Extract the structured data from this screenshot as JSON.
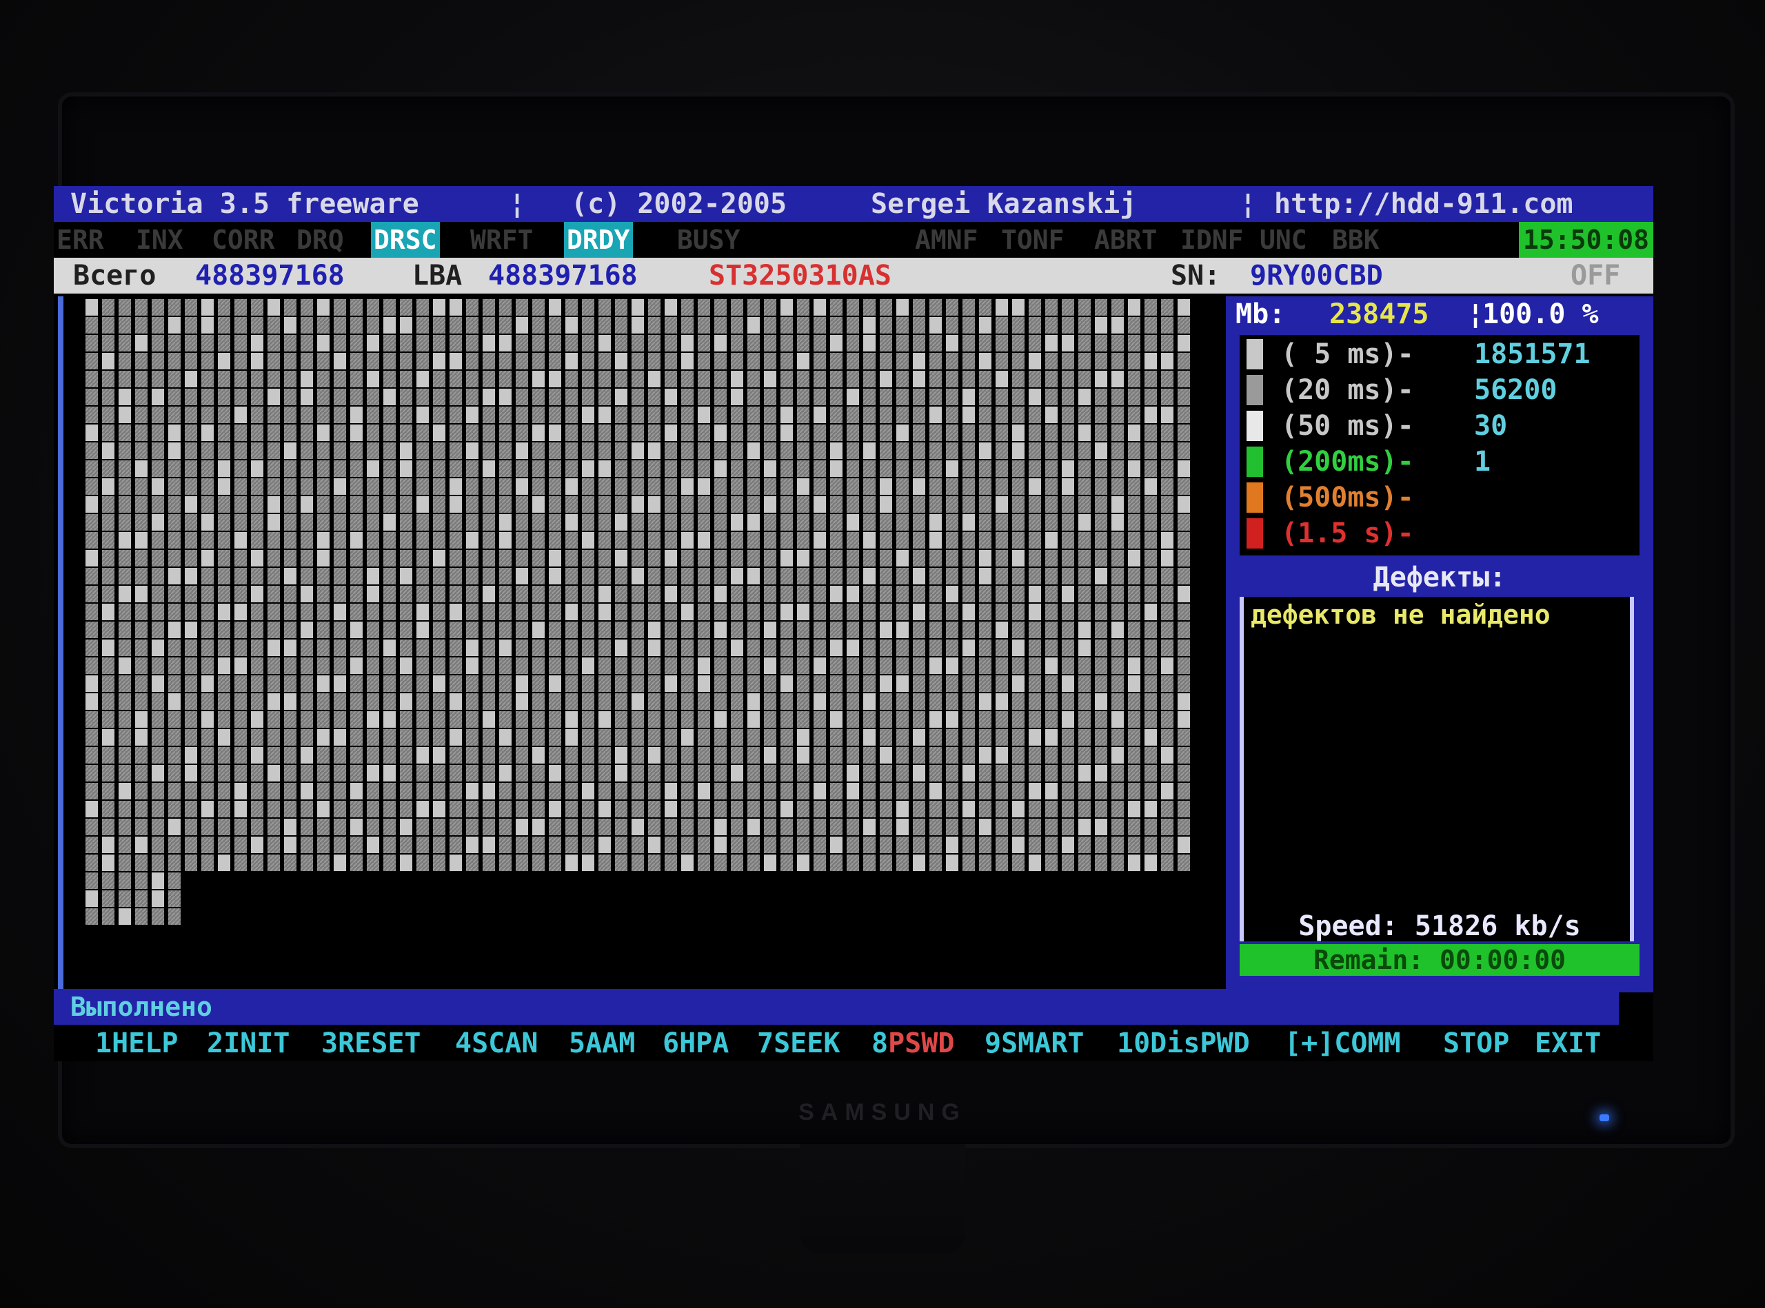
{
  "title_bar": {
    "app": "Victoria 3.5 freeware",
    "sep1": "¦",
    "copyright": "(c) 2002-2005",
    "author": "Sergei Kazanskij",
    "sep2": "¦",
    "url": "http://hdd-911.com"
  },
  "flags": [
    {
      "label": "ERR",
      "active": false
    },
    {
      "label": "INX",
      "active": false
    },
    {
      "label": "CORR",
      "active": false
    },
    {
      "label": "DRQ",
      "active": false
    },
    {
      "label": "DRSC",
      "active": true
    },
    {
      "label": "WRFT",
      "active": false
    },
    {
      "label": "DRDY",
      "active": true
    },
    {
      "label": "BUSY",
      "active": false
    },
    {
      "label": "AMNF",
      "active": false
    },
    {
      "label": "TONF",
      "active": false
    },
    {
      "label": "ABRT",
      "active": false
    },
    {
      "label": "IDNF",
      "active": false
    },
    {
      "label": "UNC",
      "active": false
    },
    {
      "label": "BBK",
      "active": false
    }
  ],
  "clock": "15:50:08",
  "info": {
    "total_label": "Всего",
    "total_value": "488397168",
    "lba_label": "LBA",
    "lba_value": "488397168",
    "model": "ST3250310AS",
    "sn_label": "SN:",
    "sn_value": "9RY00CBD",
    "state": "OFF"
  },
  "summary": {
    "mb_label": "Mb:",
    "mb_value": "238475",
    "sep": "¦",
    "percent": "100.0 %"
  },
  "timing_stats": [
    {
      "label": "( 5 ms)-",
      "count": "1851571",
      "color": "#c8c8c8",
      "label_color": "#c8c8c8"
    },
    {
      "label": "(20 ms)-",
      "count": "56200",
      "color": "#9a9a9a",
      "label_color": "#c8c8c8"
    },
    {
      "label": "(50 ms)-",
      "count": "30",
      "color": "#e8e8e8",
      "label_color": "#c8c8c8"
    },
    {
      "label": "(200ms)-",
      "count": "1",
      "color": "#22c030",
      "label_color": "#30d040"
    },
    {
      "label": "(500ms)-",
      "count": "",
      "color": "#e07820",
      "label_color": "#e08030"
    },
    {
      "label": "(1.5 s)-",
      "count": "",
      "color": "#d02020",
      "label_color": "#e03030"
    }
  ],
  "defects": {
    "header": "Дефекты:",
    "message": "дефектов не найдено"
  },
  "speed": {
    "label": "Speed:",
    "value": "51826 kb/s"
  },
  "remain": {
    "label": "Remain:",
    "value": "00:00:00"
  },
  "status_text": "Выполнено",
  "function_keys": [
    {
      "num": "1",
      "text": "HELP",
      "style": ""
    },
    {
      "num": "2",
      "text": "INIT",
      "style": ""
    },
    {
      "num": "3",
      "text": "RESET",
      "style": ""
    },
    {
      "num": "4",
      "text": "SCAN",
      "style": ""
    },
    {
      "num": "5",
      "text": "AAM",
      "style": ""
    },
    {
      "num": "6",
      "text": "HPA",
      "style": ""
    },
    {
      "num": "7",
      "text": "SEEK",
      "style": ""
    },
    {
      "num": "8",
      "text": "PSWD",
      "style": "red"
    },
    {
      "num": "9",
      "text": "SMART",
      "style": ""
    },
    {
      "num": "10",
      "text": "DisPWD",
      "style": ""
    },
    {
      "num": "[+]",
      "text": "COMM",
      "style": ""
    },
    {
      "num": "",
      "text": "STOP",
      "style": ""
    },
    {
      "num": "",
      "text": "EXIT",
      "style": ""
    }
  ],
  "monitor_brand": "SAMSUNG",
  "scan_progress": 1.0
}
